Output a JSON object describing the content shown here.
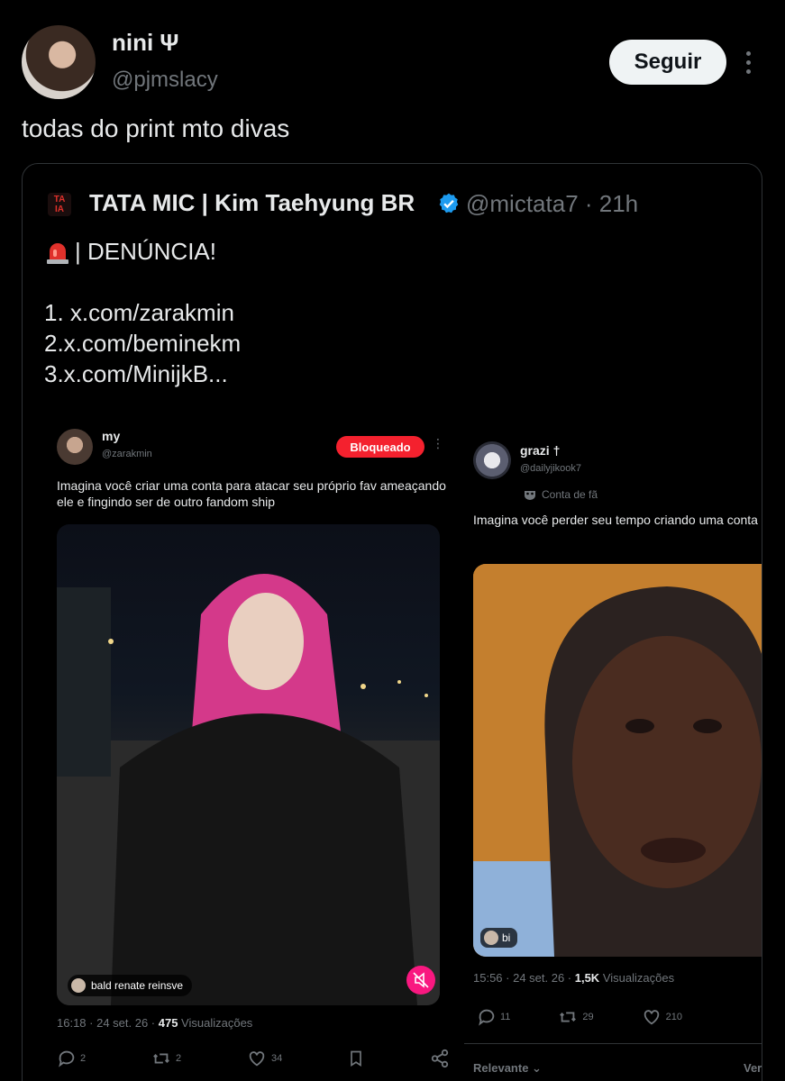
{
  "post": {
    "author_name": "nini Ψ",
    "author_handle": "@pjmslacy",
    "follow_label": "Seguir",
    "text": "todas do print mto divas"
  },
  "quote": {
    "logo_text": "TA\nIA",
    "author_name": "TATA MIC | Kim Taehyung BR",
    "handle_time": "@mictata7 · 21h",
    "line1": "| DENÚNCIA!",
    "line2": "1. x.com/zarakmin",
    "line3": "2.x.com/beminekm",
    "line4": "3.x.com/MinijkB..."
  },
  "shot1": {
    "name": "my",
    "handle": "@zarakmin",
    "badge": "Bloqueado",
    "text": "Imagina você criar uma conta para atacar seu próprio fav ameaçando ele e fingindo ser de outro fandom ship",
    "media_caption": "bald renate reinsve",
    "meta_time": "16:18 · 24 set. 26 · ",
    "meta_views": "475",
    "meta_views_label": " Visualizações",
    "replies": "2",
    "reposts": "2",
    "likes": "34"
  },
  "shot2": {
    "name": "grazi †",
    "handle": "@dailyjikook7",
    "label": "Conta de fã",
    "text": "Imagina você perder seu tempo criando uma conta pra atacar seu próprio fav",
    "media_caption": "bi",
    "meta_time": "15:56 · 24 set. 26 · ",
    "meta_views": "1,5K",
    "meta_views_label": " Visualizações",
    "replies": "11",
    "reposts": "29",
    "likes": "210",
    "sort_label": "Relevante",
    "more_label": "Ver"
  },
  "colors": {
    "background": "#000000",
    "text": "#e7e9ea",
    "muted": "#71767b",
    "verified": "#1d9bf0",
    "blocked_badge": "#f4212e"
  }
}
